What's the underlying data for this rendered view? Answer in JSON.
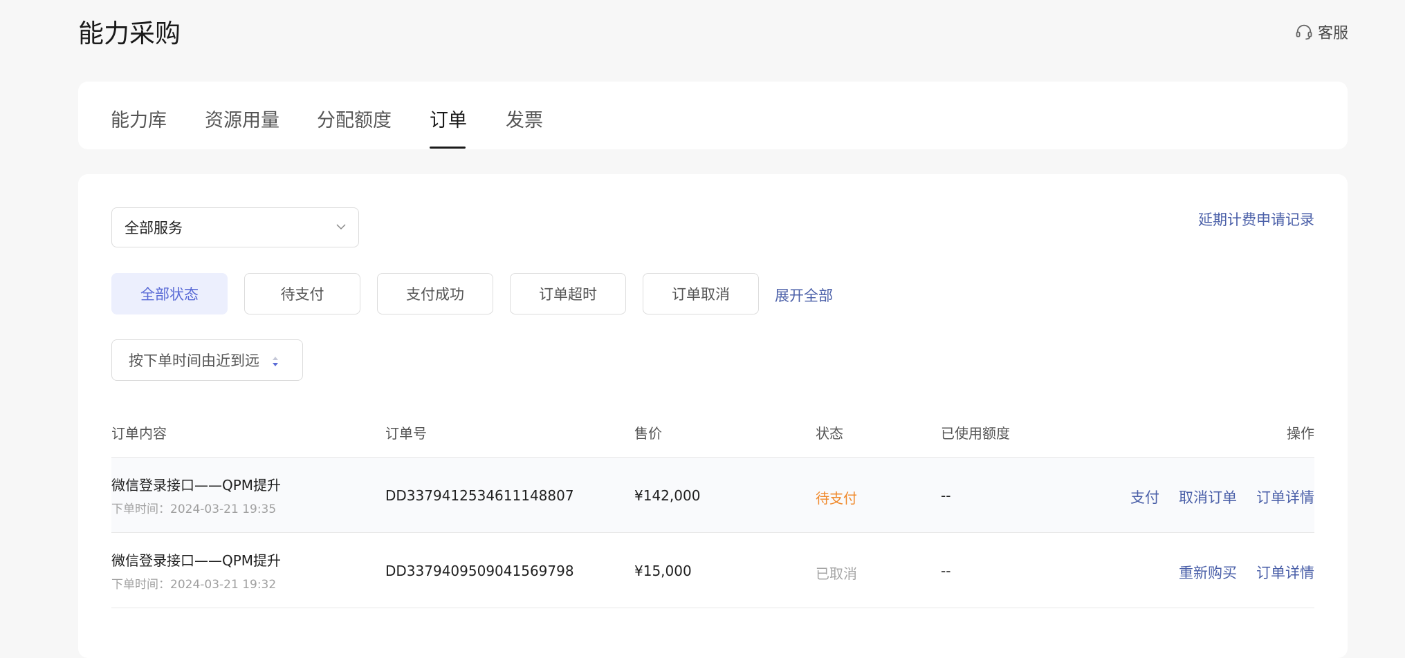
{
  "page_title": "能力采购",
  "support_label": "客服",
  "tabs": [
    {
      "label": "能力库"
    },
    {
      "label": "资源用量"
    },
    {
      "label": "分配额度"
    },
    {
      "label": "订单"
    },
    {
      "label": "发票"
    }
  ],
  "active_tab": "订单",
  "service_select": {
    "value": "全部服务"
  },
  "deferred_link": "延期计费申请记录",
  "filters": [
    "全部状态",
    "待支付",
    "支付成功",
    "订单超时",
    "订单取消"
  ],
  "active_filter": "全部状态",
  "expand_all": "展开全部",
  "sort_label": "按下单时间由近到远",
  "table": {
    "headers": {
      "content": "订单内容",
      "order_no": "订单号",
      "price": "售价",
      "status": "状态",
      "used": "已使用额度",
      "ops": "操作"
    },
    "rows": [
      {
        "title": "微信登录接口——QPM提升",
        "time": "下单时间：2024-03-21 19:35",
        "order_no": "DD3379412534611148807",
        "price": "¥142,000",
        "status": "待支付",
        "used": "--",
        "actions": [
          "支付",
          "取消订单",
          "订单详情"
        ]
      },
      {
        "title": "微信登录接口——QPM提升",
        "time": "下单时间：2024-03-21 19:32",
        "order_no": "DD3379409509041569798",
        "price": "¥15,000",
        "status": "已取消",
        "used": "--",
        "actions": [
          "重新购买",
          "订单详情"
        ]
      }
    ]
  },
  "colors": {
    "accent_link": "#4a5fa8",
    "active_filter_bg": "#eceffd",
    "active_filter_text": "#5a6bd6",
    "pending": "#f08a2d",
    "cancelled": "#a5a5a5"
  },
  "icons": {
    "support": "headset-icon",
    "select": "chevron-down-icon",
    "sort": "sort-updown-icon"
  }
}
